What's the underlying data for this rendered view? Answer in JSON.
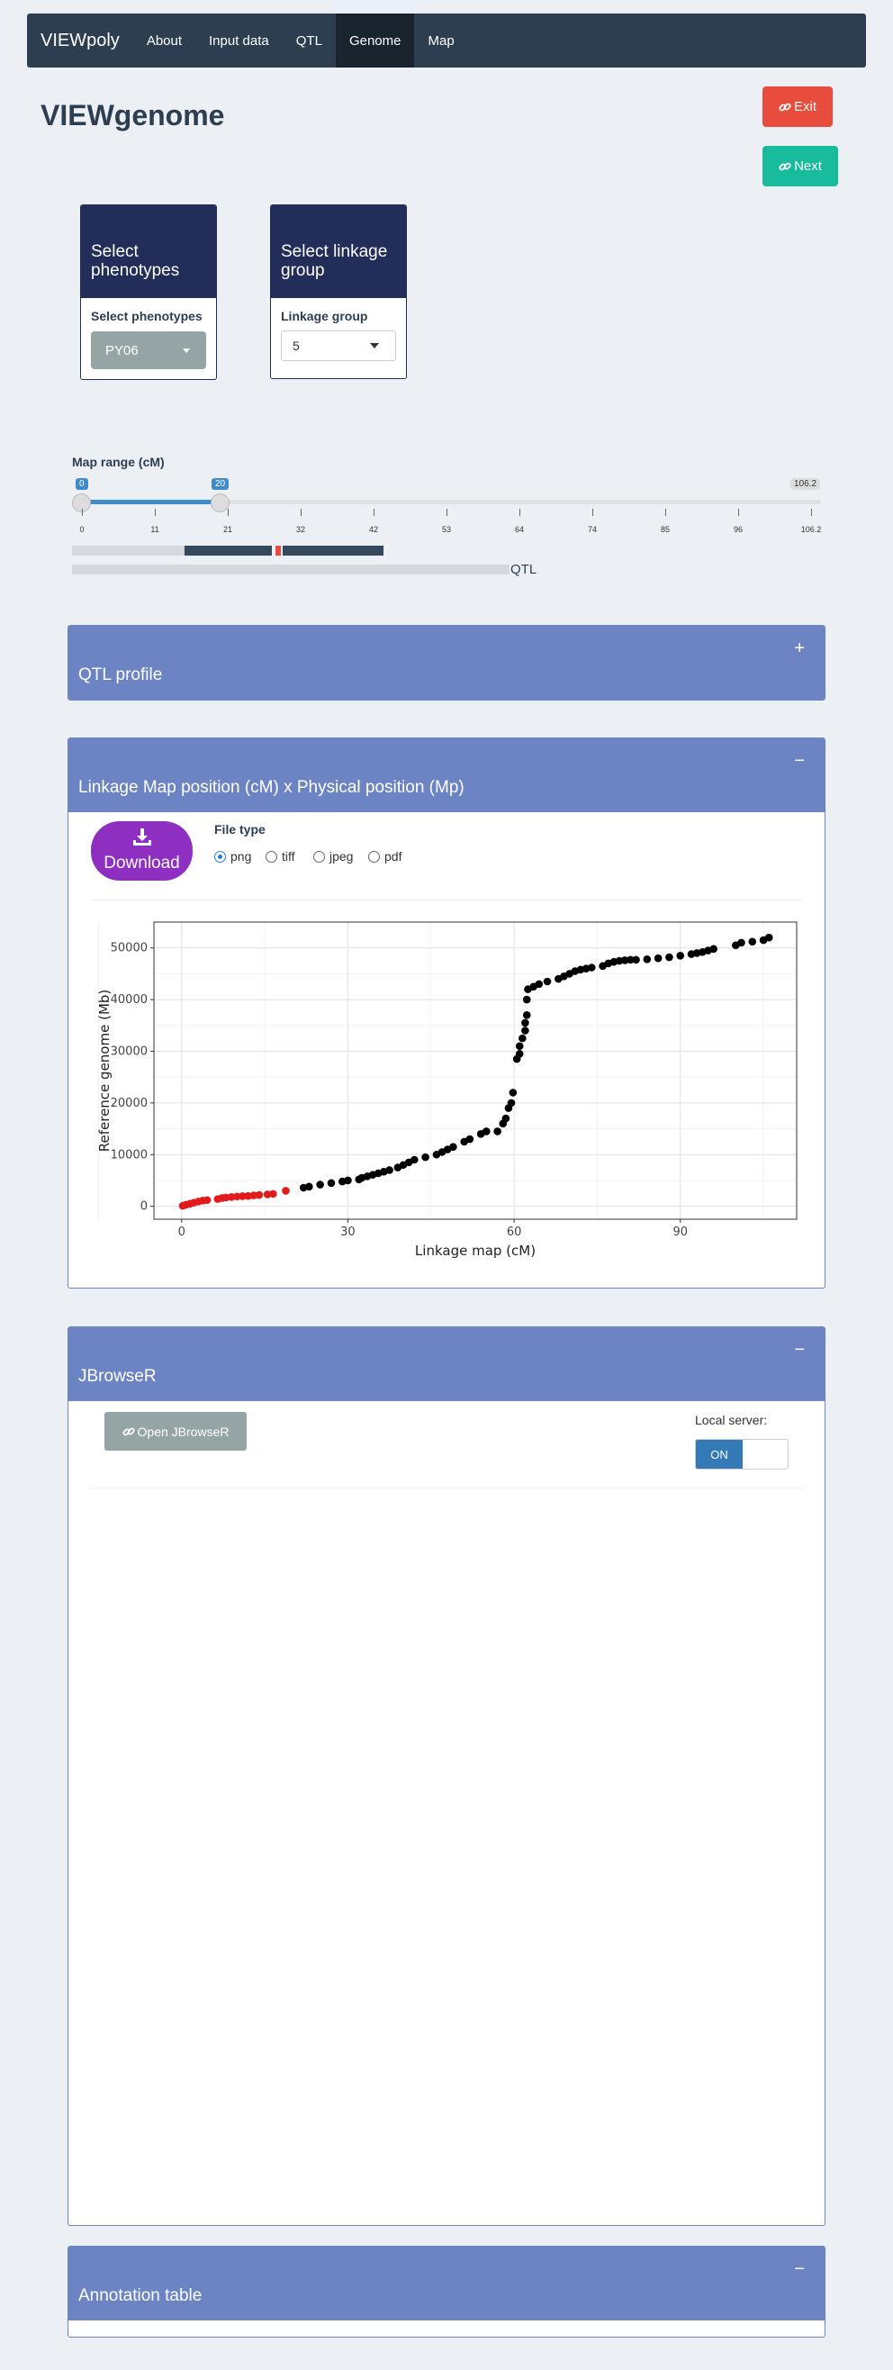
{
  "navbar": {
    "brand": "VIEWpoly",
    "items": [
      {
        "label": "About",
        "active": false
      },
      {
        "label": "Input data",
        "active": false
      },
      {
        "label": "QTL",
        "active": false
      },
      {
        "label": "Genome",
        "active": true
      },
      {
        "label": "Map",
        "active": false
      }
    ]
  },
  "page": {
    "title": "VIEWgenome",
    "exit_label": "Exit",
    "next_label": "Next"
  },
  "phenotypes_box": {
    "header": "Select phenotypes",
    "label": "Select phenotypes",
    "selected": "PY06"
  },
  "linkage_box": {
    "header": "Select linkage group",
    "label": "Linkage group",
    "selected": "5"
  },
  "map_range": {
    "label": "Map range (cM)",
    "from": "0",
    "to": "20",
    "max": "106.2",
    "ticks": [
      "0",
      "11",
      "21",
      "32",
      "42",
      "53",
      "64",
      "74",
      "85",
      "96",
      "106.2"
    ],
    "qtl_label": "QTL"
  },
  "panels": {
    "qtl_profile": {
      "title": "QTL profile",
      "tool": "+"
    },
    "linkage_physical": {
      "title": "Linkage Map position (cM) x Physical position (Mp)",
      "tool": "−",
      "download_label": "Download",
      "file_type_label": "File type",
      "file_types": [
        "png",
        "tiff",
        "jpeg",
        "pdf"
      ],
      "selected_file_type": "png"
    },
    "jbrowse": {
      "title": "JBrowseR",
      "tool": "−",
      "open_label": "Open JBrowseR",
      "local_server_label": "Local server:",
      "toggle_on": "ON"
    },
    "annotation": {
      "title": "Annotation table",
      "tool": "−"
    }
  },
  "chart_data": {
    "type": "scatter",
    "xlabel": "Linkage map (cM)",
    "ylabel": "Reference genome (Mb)",
    "xlim": [
      -5,
      111
    ],
    "ylim": [
      -2500,
      55000
    ],
    "xticks": [
      0,
      30,
      60,
      90
    ],
    "yticks": [
      0,
      10000,
      20000,
      30000,
      40000,
      50000
    ],
    "grid": true,
    "highlight_color": "#e31a1c",
    "point_color": "#000000",
    "series": [
      {
        "color": "#e31a1c",
        "points": [
          [
            0.2,
            100
          ],
          [
            0.8,
            300
          ],
          [
            1.5,
            500
          ],
          [
            2.2,
            700
          ],
          [
            3,
            900
          ],
          [
            3.8,
            1100
          ],
          [
            4.6,
            1200
          ],
          [
            6.5,
            1400
          ],
          [
            7.3,
            1600
          ],
          [
            8,
            1700
          ],
          [
            9,
            1800
          ],
          [
            10,
            1900
          ],
          [
            11,
            1950
          ],
          [
            12,
            2000
          ],
          [
            13,
            2100
          ],
          [
            14,
            2200
          ],
          [
            15.5,
            2300
          ],
          [
            16.5,
            2400
          ],
          [
            18.8,
            3000
          ]
        ]
      },
      {
        "color": "#000000",
        "points": [
          [
            22,
            3600
          ],
          [
            23,
            3800
          ],
          [
            25,
            4200
          ],
          [
            27,
            4500
          ],
          [
            29,
            4800
          ],
          [
            30,
            5000
          ],
          [
            32,
            5200
          ],
          [
            32.5,
            5500
          ],
          [
            33.5,
            5800
          ],
          [
            34.5,
            6100
          ],
          [
            35.5,
            6400
          ],
          [
            36.5,
            6700
          ],
          [
            37.5,
            7000
          ],
          [
            39,
            7500
          ],
          [
            40,
            8000
          ],
          [
            41,
            8500
          ],
          [
            42,
            9000
          ],
          [
            44,
            9500
          ],
          [
            46,
            10000
          ],
          [
            47,
            10500
          ],
          [
            48,
            11000
          ],
          [
            49,
            11500
          ],
          [
            51,
            12500
          ],
          [
            52,
            13000
          ],
          [
            54,
            14000
          ],
          [
            55,
            14500
          ],
          [
            57,
            14500
          ],
          [
            58,
            16000
          ],
          [
            58.5,
            17000
          ],
          [
            59,
            19000
          ],
          [
            59.5,
            20000
          ],
          [
            59.8,
            22000
          ],
          [
            60.5,
            28500
          ],
          [
            61,
            29500
          ],
          [
            61,
            31000
          ],
          [
            61.5,
            32500
          ],
          [
            62,
            34000
          ],
          [
            62,
            35500
          ],
          [
            62.3,
            37000
          ],
          [
            62.3,
            40000
          ],
          [
            62.5,
            42000
          ],
          [
            63.5,
            42500
          ],
          [
            64.5,
            43000
          ],
          [
            66,
            43500
          ],
          [
            68,
            44000
          ],
          [
            69,
            44500
          ],
          [
            70,
            45000
          ],
          [
            71,
            45500
          ],
          [
            72,
            45800
          ],
          [
            73,
            46000
          ],
          [
            74,
            46200
          ],
          [
            76,
            46500
          ],
          [
            77,
            47000
          ],
          [
            78,
            47300
          ],
          [
            79,
            47500
          ],
          [
            80,
            47600
          ],
          [
            81,
            47700
          ],
          [
            82,
            47700
          ],
          [
            84,
            47800
          ],
          [
            86,
            48000
          ],
          [
            88,
            48200
          ],
          [
            90,
            48500
          ],
          [
            92,
            48800
          ],
          [
            93,
            49000
          ],
          [
            94,
            49200
          ],
          [
            95,
            49500
          ],
          [
            96,
            49800
          ],
          [
            100,
            50500
          ],
          [
            101,
            51000
          ],
          [
            103,
            51200
          ],
          [
            105,
            51500
          ],
          [
            106,
            52000
          ]
        ]
      }
    ]
  }
}
